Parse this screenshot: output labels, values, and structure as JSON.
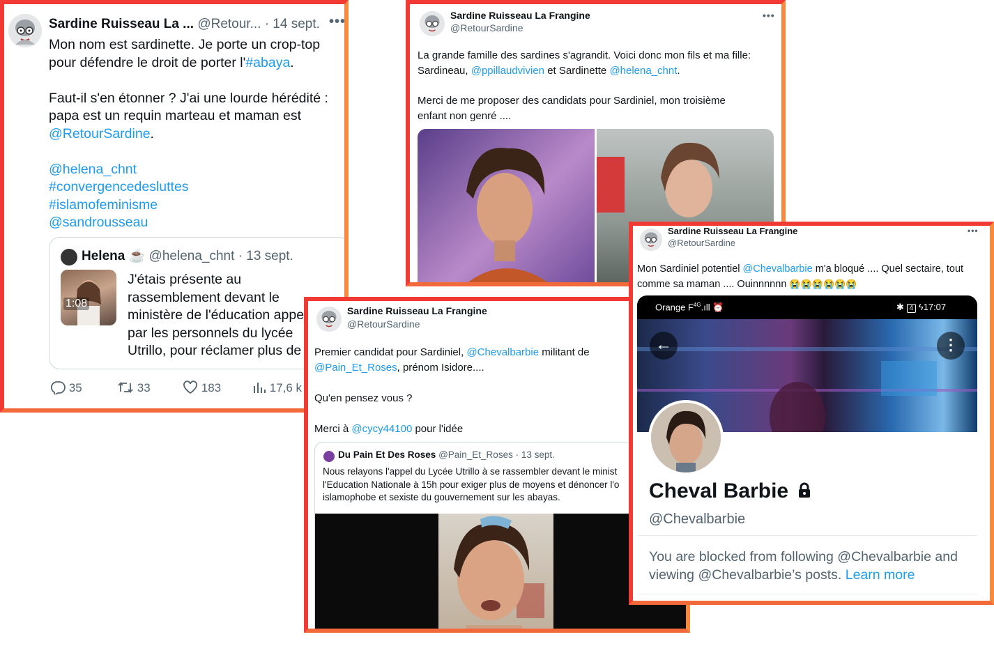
{
  "card1": {
    "name": "Sardine Ruisseau La ...",
    "handle": "@Retour...",
    "date": "· 14 sept.",
    "line1": "Mon nom est sardinette. Je porte un crop-top",
    "line2_pre": "pour défendre le droit de porter l'",
    "line2_tag": "#abaya",
    "line2_post": ".",
    "para2_l1": "Faut-il s'en étonner ? J'ai une lourde hérédité :",
    "para2_l2": "papa est un requin marteau et maman est",
    "para2_mention": "@RetourSardine",
    "para2_post": ".",
    "tags": [
      "@helena_chnt",
      "#convergencedesluttes",
      "#islamofeminisme",
      "@sandrousseau"
    ],
    "quote": {
      "name": "Helena",
      "emoji": "☕",
      "handle": "@helena_chnt · 13 sept.",
      "duration": "1:08",
      "lines": [
        "J'étais présente au",
        "rassemblement devant le",
        "ministère de l'éducation appe",
        "par les personnels du lycée",
        "Utrillo, pour réclamer plus de"
      ]
    },
    "stats": {
      "replies": "35",
      "retweets": "33",
      "likes": "183",
      "views": "17,6 k"
    }
  },
  "card2": {
    "name": "Sardine Ruisseau La Frangine",
    "handle": "@RetourSardine",
    "l1": "La grande famille des sardines s'agrandit. Voici donc mon fils et ma fille:",
    "l2_pre": "Sardineau, ",
    "l2_m1": "@ppillaudvivien",
    "l2_mid": " et Sardinette ",
    "l2_m2": "@helena_chnt",
    "l2_post": ".",
    "l3": "Merci de me proposer des candidats pour Sardiniel, mon troisième",
    "l4": "enfant non genré ...."
  },
  "card3": {
    "name": "Sardine Ruisseau La Frangine",
    "handle": "@RetourSardine",
    "l1_pre": "Premier candidat pour Sardiniel, ",
    "l1_m": "@Chevalbarbie",
    "l1_post": " militant de",
    "l2_m": "@Pain_Et_Roses",
    "l2_post": ", prénom Isidore....",
    "l3": "Qu'en pensez vous ?",
    "l4_pre": "Merci à ",
    "l4_m": "@cycy44100",
    "l4_post": " pour l'idée",
    "quote": {
      "name": "Du Pain Et Des Roses",
      "handle": "@Pain_Et_Roses · 13 sept.",
      "lines": [
        "Nous relayons l'appel du Lycée Utrillo à se rassembler devant le minist",
        "l'Education Nationale à 15h pour exiger plus de moyens et dénoncer l'o",
        "islamophobe et sexiste du gouvernement sur les abayas."
      ]
    }
  },
  "card4": {
    "name": "Sardine Ruisseau La Frangine",
    "handle": "@RetourSardine",
    "l1_pre": "Mon Sardiniel potentiel ",
    "l1_m": "@Chevalbarbie",
    "l1_post": " m'a bloqué .... Quel sectaire, tout",
    "l2": "comme sa maman .... Ouinnnnnn",
    "emojis": "😭😭😭😭😭😭",
    "phone": {
      "carrier": "Orange F",
      "network": "4G",
      "battery": "4",
      "time": "17:07",
      "profile_name": "Cheval Barbie",
      "profile_handle": "@Chevalbarbie",
      "blocked_l1": "You are blocked from following @Chevalbarbie and",
      "blocked_l2_pre": "viewing @Chevalbarbie’s posts. ",
      "learn_more": "Learn more"
    }
  },
  "colors": {
    "link": "#1d9bf0",
    "frame_red": "#f23a35",
    "frame_orange": "#f78a3f"
  }
}
